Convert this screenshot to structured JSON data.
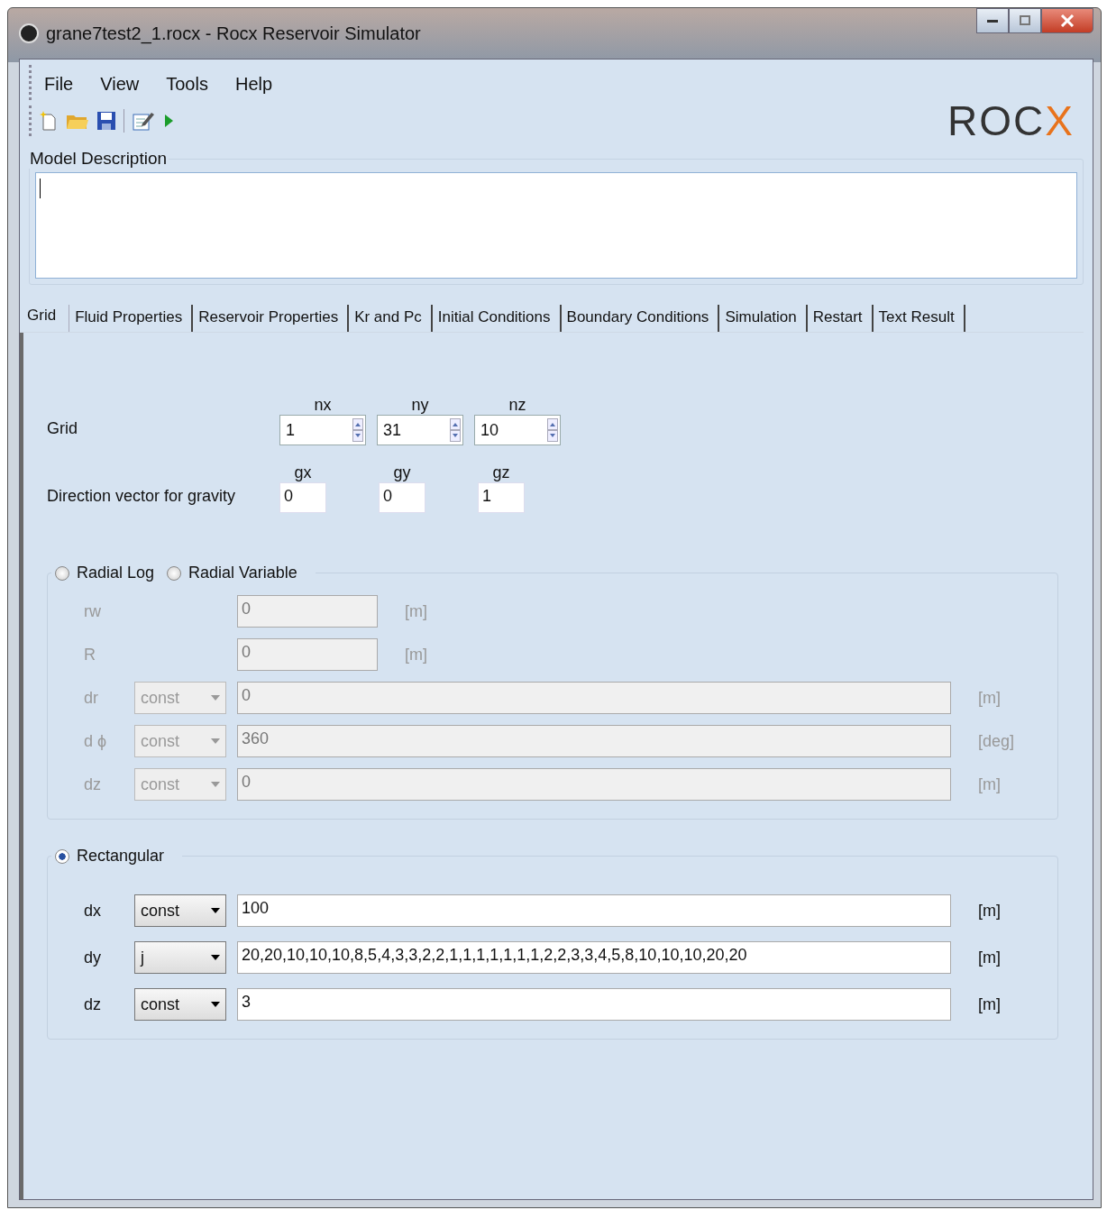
{
  "window": {
    "title": "grane7test2_1.rocx - Rocx Reservoir Simulator"
  },
  "menu": [
    "File",
    "View",
    "Tools",
    "Help"
  ],
  "logo": {
    "main": "ROC",
    "accent": "X"
  },
  "model_description": {
    "label": "Model Description"
  },
  "tabs": [
    {
      "label": "Grid",
      "selected": true
    },
    {
      "label": "Fluid Properties",
      "selected": false
    },
    {
      "label": "Reservoir Properties",
      "selected": false
    },
    {
      "label": "Kr and Pc",
      "selected": false
    },
    {
      "label": "Initial Conditions",
      "selected": false
    },
    {
      "label": "Boundary Conditions",
      "selected": false
    },
    {
      "label": "Simulation",
      "selected": false
    },
    {
      "label": "Restart",
      "selected": false
    },
    {
      "label": "Text Result",
      "selected": false
    }
  ],
  "grid": {
    "label": "Grid",
    "spinners": [
      {
        "label": "nx",
        "value": "1"
      },
      {
        "label": "ny",
        "value": "31"
      },
      {
        "label": "nz",
        "value": "10"
      }
    ]
  },
  "gravity": {
    "label": "Direction vector for gravity",
    "fields": [
      {
        "label": "gx",
        "value": "0"
      },
      {
        "label": "gy",
        "value": "0"
      },
      {
        "label": "gz",
        "value": "1"
      }
    ]
  },
  "radial": {
    "disabled": true,
    "options": [
      {
        "label": "Radial Log",
        "selected": false
      },
      {
        "label": "Radial Variable",
        "selected": false
      }
    ],
    "rows": [
      {
        "kind": "plain",
        "label": "rw",
        "value": "0",
        "unit": "[m]"
      },
      {
        "kind": "plain",
        "label": "R",
        "value": "0",
        "unit": "[m]"
      },
      {
        "kind": "select",
        "label": "dr",
        "mode": "const",
        "value": "0",
        "unit": "[m]"
      },
      {
        "kind": "select",
        "label": "d ϕ",
        "mode": "const",
        "value": "360",
        "unit": "[deg]"
      },
      {
        "kind": "select",
        "label": "dz",
        "mode": "const",
        "value": "0",
        "unit": "[m]"
      }
    ]
  },
  "rectangular": {
    "disabled": false,
    "option": {
      "label": "Rectangular",
      "selected": true
    },
    "rows": [
      {
        "kind": "select",
        "label": "dx",
        "mode": "const",
        "value": "100",
        "unit": "[m]"
      },
      {
        "kind": "select",
        "label": "dy",
        "mode": "j",
        "value": "20,20,10,10,10,8,5,4,3,3,2,2,1,1,1,1,1,1,1,2,2,3,3,4,5,8,10,10,10,20,20",
        "unit": "[m]"
      },
      {
        "kind": "select",
        "label": "dz",
        "mode": "const",
        "value": "3",
        "unit": "[m]"
      }
    ]
  }
}
